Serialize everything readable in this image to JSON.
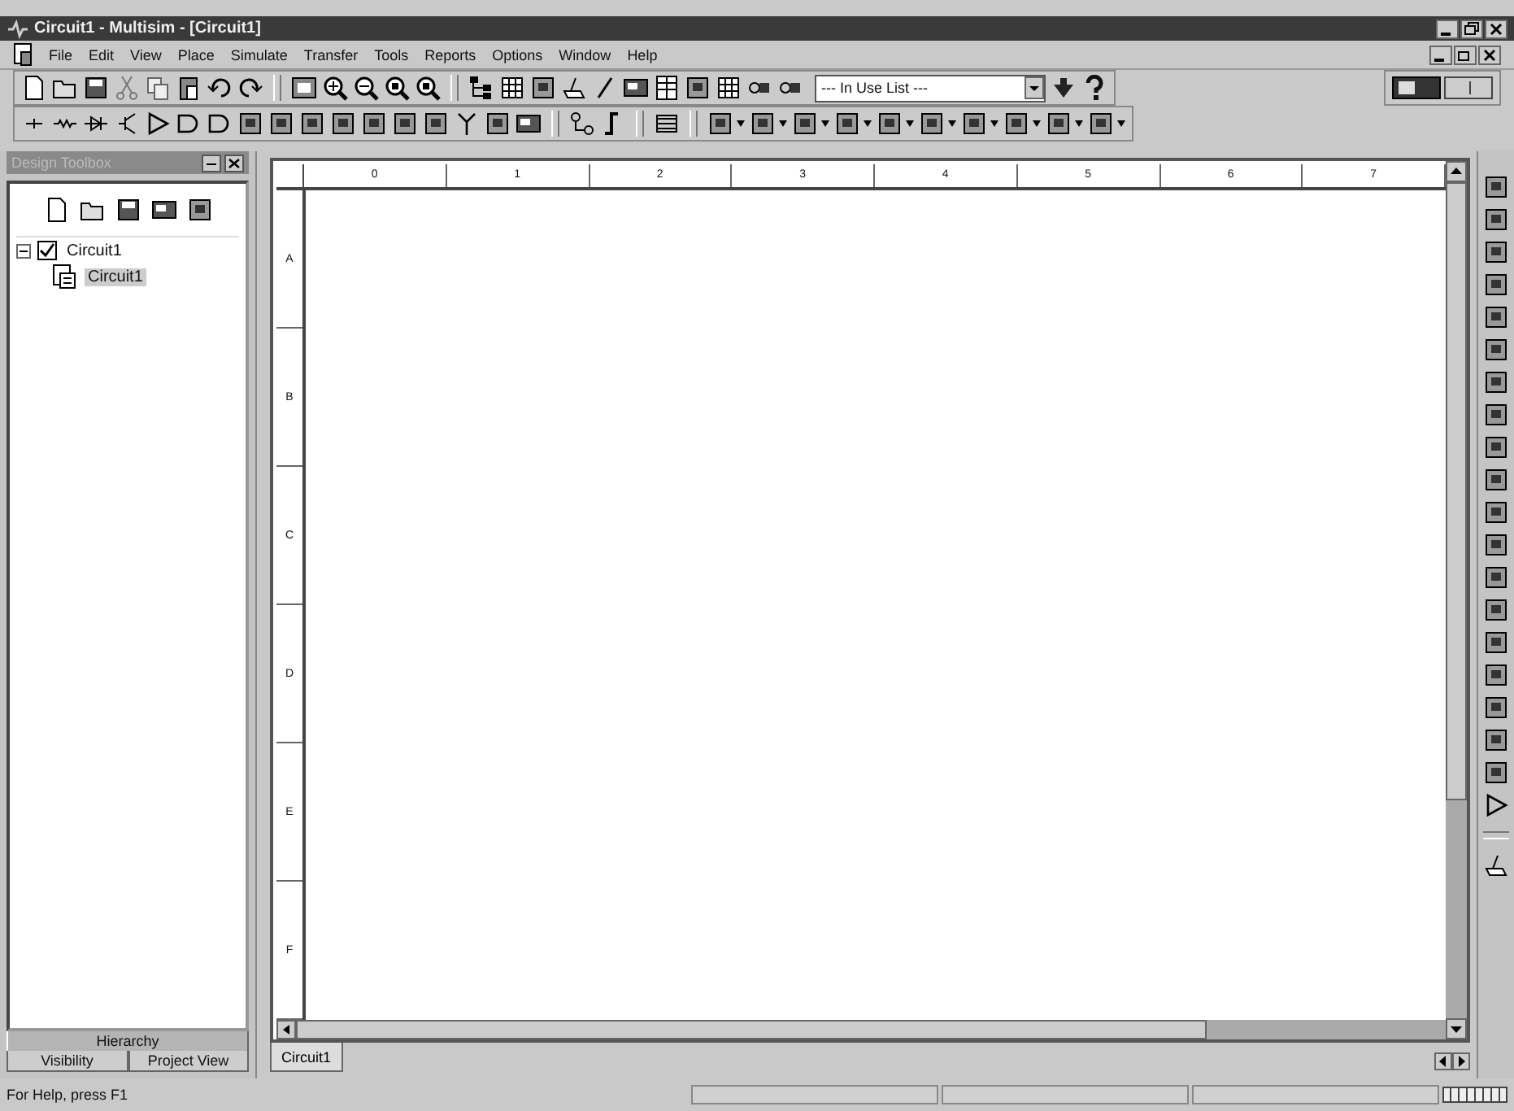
{
  "window": {
    "title": "Circuit1 - Multisim - [Circuit1]"
  },
  "menu": [
    {
      "label": "File"
    },
    {
      "label": "Edit"
    },
    {
      "label": "View"
    },
    {
      "label": "Place"
    },
    {
      "label": "Simulate"
    },
    {
      "label": "Transfer"
    },
    {
      "label": "Tools"
    },
    {
      "label": "Reports"
    },
    {
      "label": "Options"
    },
    {
      "label": "Window"
    },
    {
      "label": "Help"
    }
  ],
  "in_use_list": {
    "value": "--- In Use List ---"
  },
  "design_toolbox": {
    "title": "Design Toolbox",
    "tree": [
      {
        "label": "Circuit1",
        "checked": true,
        "expanded": true,
        "children": [
          {
            "label": "Circuit1",
            "selected": true
          }
        ]
      }
    ],
    "tabs": [
      {
        "label": "Hierarchy",
        "selected": true
      },
      {
        "label": "Visibility",
        "selected": false
      },
      {
        "label": "Project View",
        "selected": false
      }
    ]
  },
  "sheet": {
    "columns": [
      "0",
      "1",
      "2",
      "3",
      "4",
      "5",
      "6",
      "7"
    ],
    "rows": [
      "A",
      "B",
      "C",
      "D",
      "E",
      "F"
    ]
  },
  "document_tabs": [
    {
      "label": "Circuit1",
      "selected": true
    }
  ],
  "status_bar": {
    "text": "For Help, press F1"
  }
}
